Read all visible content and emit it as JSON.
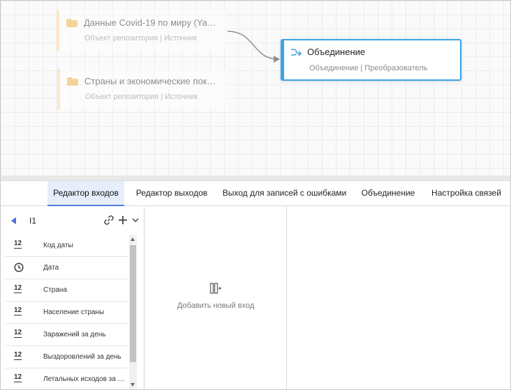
{
  "canvas": {
    "nodes": [
      {
        "title": "Данные Covid-19 по миру (Ya…",
        "subtitle": "Объект репозитория | Источник"
      },
      {
        "title": "Страны и экономические пок…",
        "subtitle": "Объект репозитория | Источник"
      },
      {
        "title": "Объединение",
        "subtitle": "Объединение | Преобразователь"
      }
    ]
  },
  "tabs": [
    {
      "label": "Редактор входов"
    },
    {
      "label": "Редактор выходов"
    },
    {
      "label": "Выход для записей с ошибками"
    },
    {
      "label": "Объединение"
    },
    {
      "label": "Настройка связей"
    }
  ],
  "left_panel": {
    "input_name": "I1",
    "fields": [
      {
        "type_label": "12",
        "name": "Код даты"
      },
      {
        "type_label": "",
        "name": "Дата"
      },
      {
        "type_label": "12",
        "name": "Страна"
      },
      {
        "type_label": "12",
        "name": "Население страны"
      },
      {
        "type_label": "12",
        "name": "Заражений за день"
      },
      {
        "type_label": "12",
        "name": "Выздоровлений за день"
      },
      {
        "type_label": "12",
        "name": "Летальных исходов за …"
      }
    ]
  },
  "middle_panel": {
    "add_input_label": "Добавить новый вход"
  },
  "colors": {
    "accent": "#39a6e8",
    "source_border": "#ffd9a0",
    "tab_active_bg": "#e6eefb",
    "tab_active_line": "#4c7fe0"
  }
}
